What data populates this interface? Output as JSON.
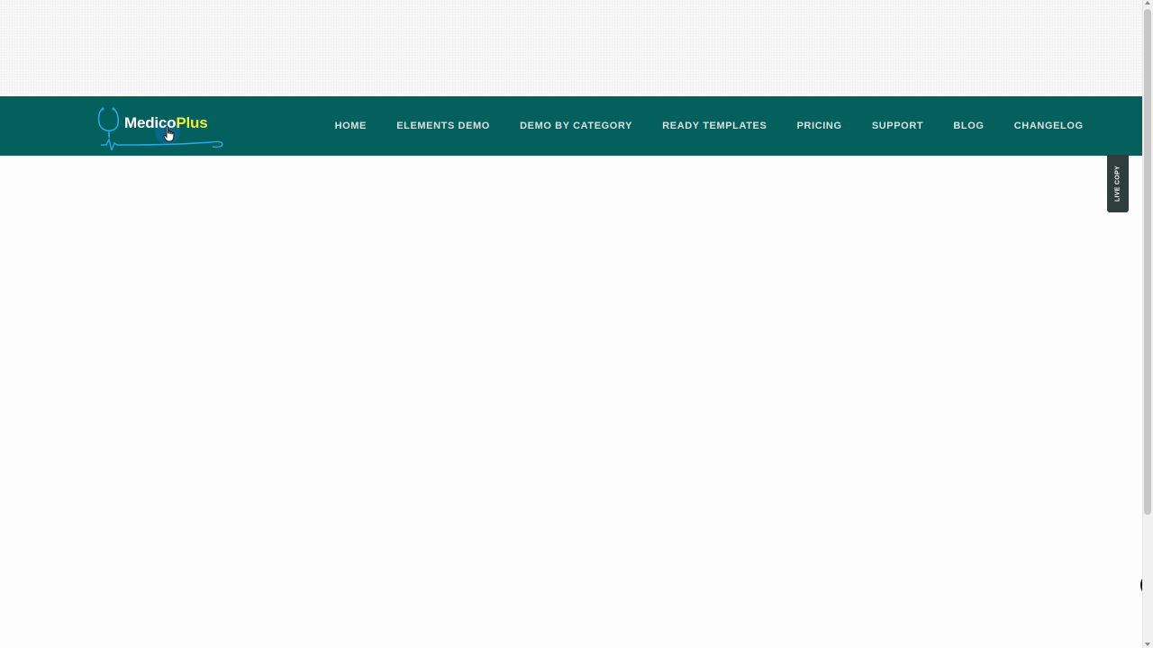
{
  "logo": {
    "text_part1": "Medico",
    "text_part2": "Plus",
    "icon": "stethoscope-icon",
    "accent_color": "#f2ef3a"
  },
  "nav": {
    "background_color": "#03605c",
    "items": [
      {
        "label": "HOME"
      },
      {
        "label": "ELEMENTS DEMO"
      },
      {
        "label": "DEMO BY CATEGORY"
      },
      {
        "label": "READY TEMPLATES"
      },
      {
        "label": "PRICING"
      },
      {
        "label": "SUPPORT"
      },
      {
        "label": "BLOG"
      },
      {
        "label": "CHANGELOG"
      }
    ]
  },
  "side_tab": {
    "label": "LIVE COPY"
  },
  "floating_button": {
    "icon": "chevron-left-icon"
  },
  "cursor": {
    "icon": "hand-pointer-icon"
  }
}
